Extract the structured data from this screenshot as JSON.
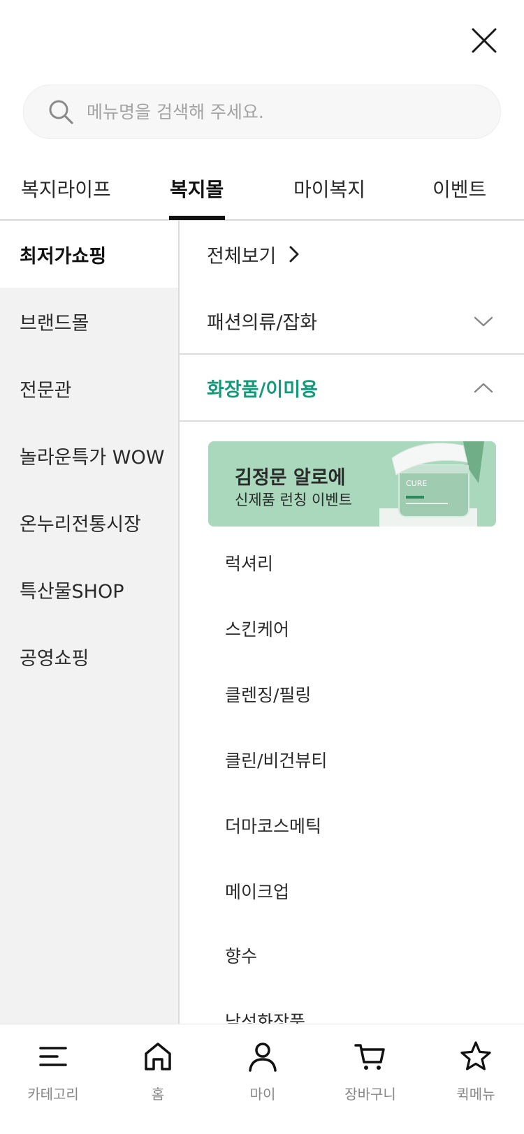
{
  "header": {
    "close_icon": "close-icon"
  },
  "search": {
    "placeholder": "메뉴명을 검색해 주세요.",
    "icon": "search-icon"
  },
  "tabs": [
    {
      "label": "복지라이프",
      "active": false
    },
    {
      "label": "복지몰",
      "active": true
    },
    {
      "label": "마이복지",
      "active": false
    },
    {
      "label": "이벤트",
      "active": false
    }
  ],
  "sidebar": {
    "items": [
      {
        "label": "최저가쇼핑",
        "active": true
      },
      {
        "label": "브랜드몰",
        "active": false
      },
      {
        "label": "전문관",
        "active": false
      },
      {
        "label": "놀라운특가 WOW",
        "active": false
      },
      {
        "label": "온누리전통시장",
        "active": false
      },
      {
        "label": "특산물SHOP",
        "active": false
      },
      {
        "label": "공영쇼핑",
        "active": false
      }
    ]
  },
  "content": {
    "view_all": "전체보기",
    "categories": [
      {
        "label": "패션의류/잡화",
        "expanded": false
      },
      {
        "label": "화장품/이미용",
        "expanded": true
      }
    ],
    "banner": {
      "title": "김정문 알로에",
      "subtitle": "신제품 런칭 이벤트",
      "jar_brand": "CURE"
    },
    "sub_items": [
      "럭셔리",
      "스킨케어",
      "클렌징/필링",
      "클린/비건뷰티",
      "더마코스메틱",
      "메이크업",
      "향수",
      "남성화장품"
    ]
  },
  "bottom_nav": [
    {
      "label": "카테고리",
      "icon": "menu-icon"
    },
    {
      "label": "홈",
      "icon": "home-icon"
    },
    {
      "label": "마이",
      "icon": "user-icon"
    },
    {
      "label": "장바구니",
      "icon": "cart-icon"
    },
    {
      "label": "퀵메뉴",
      "icon": "star-icon"
    }
  ],
  "colors": {
    "accent": "#16997a",
    "sidebar_bg": "#f2f2f2",
    "banner_bg": "#a9d8bd"
  }
}
